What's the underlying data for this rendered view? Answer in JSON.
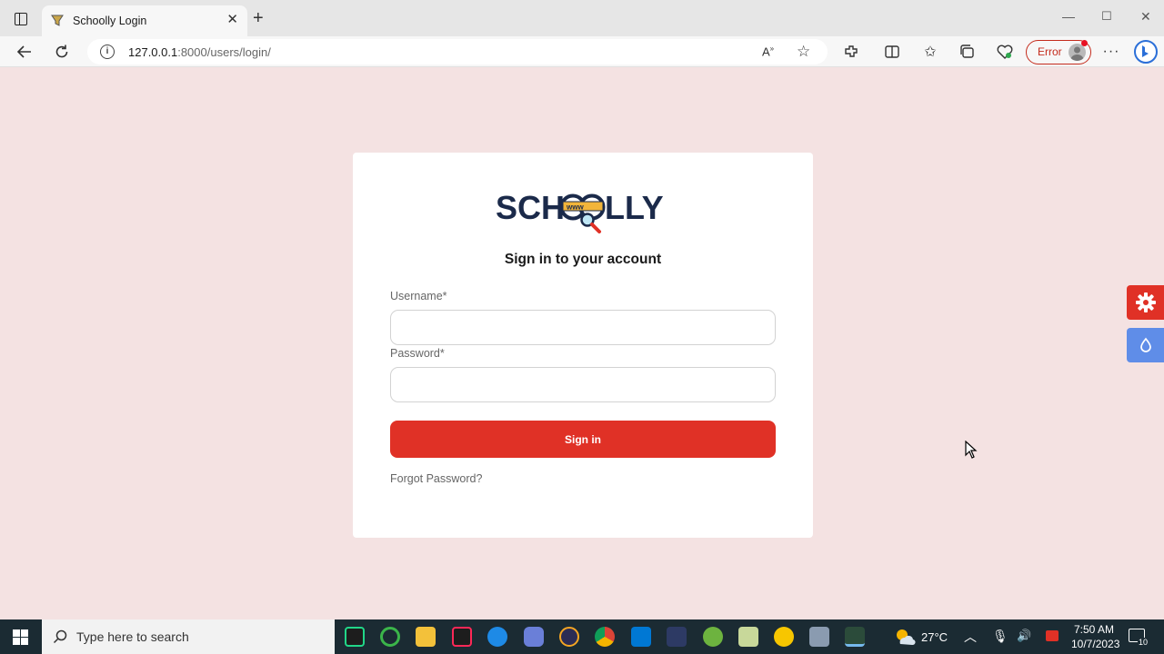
{
  "browser": {
    "tab_title": "Schoolly Login",
    "url_host": "127.0.0.1",
    "url_path": ":8000/users/login/",
    "profile_status": "Error"
  },
  "login": {
    "logo_text": "SCHOOLLY",
    "heading": "Sign in to your account",
    "username_label": "Username*",
    "username_value": "",
    "password_label": "Password*",
    "password_value": "",
    "signin_label": "Sign in",
    "forgot_label": "Forgot Password?"
  },
  "taskbar": {
    "search_placeholder": "Type here to search",
    "temperature": "27°C",
    "time": "7:50 AM",
    "date": "10/7/2023",
    "notification_count": "10"
  },
  "colors": {
    "page_bg": "#f4e2e2",
    "primary_red": "#e03126",
    "settings_red": "#e03126",
    "theme_blue": "#5f8de8",
    "logo_navy": "#1b2a4a",
    "logo_gold": "#f2b53a"
  },
  "icons": [
    "gear-icon",
    "drop-icon",
    "search-icon",
    "windows-icon"
  ]
}
